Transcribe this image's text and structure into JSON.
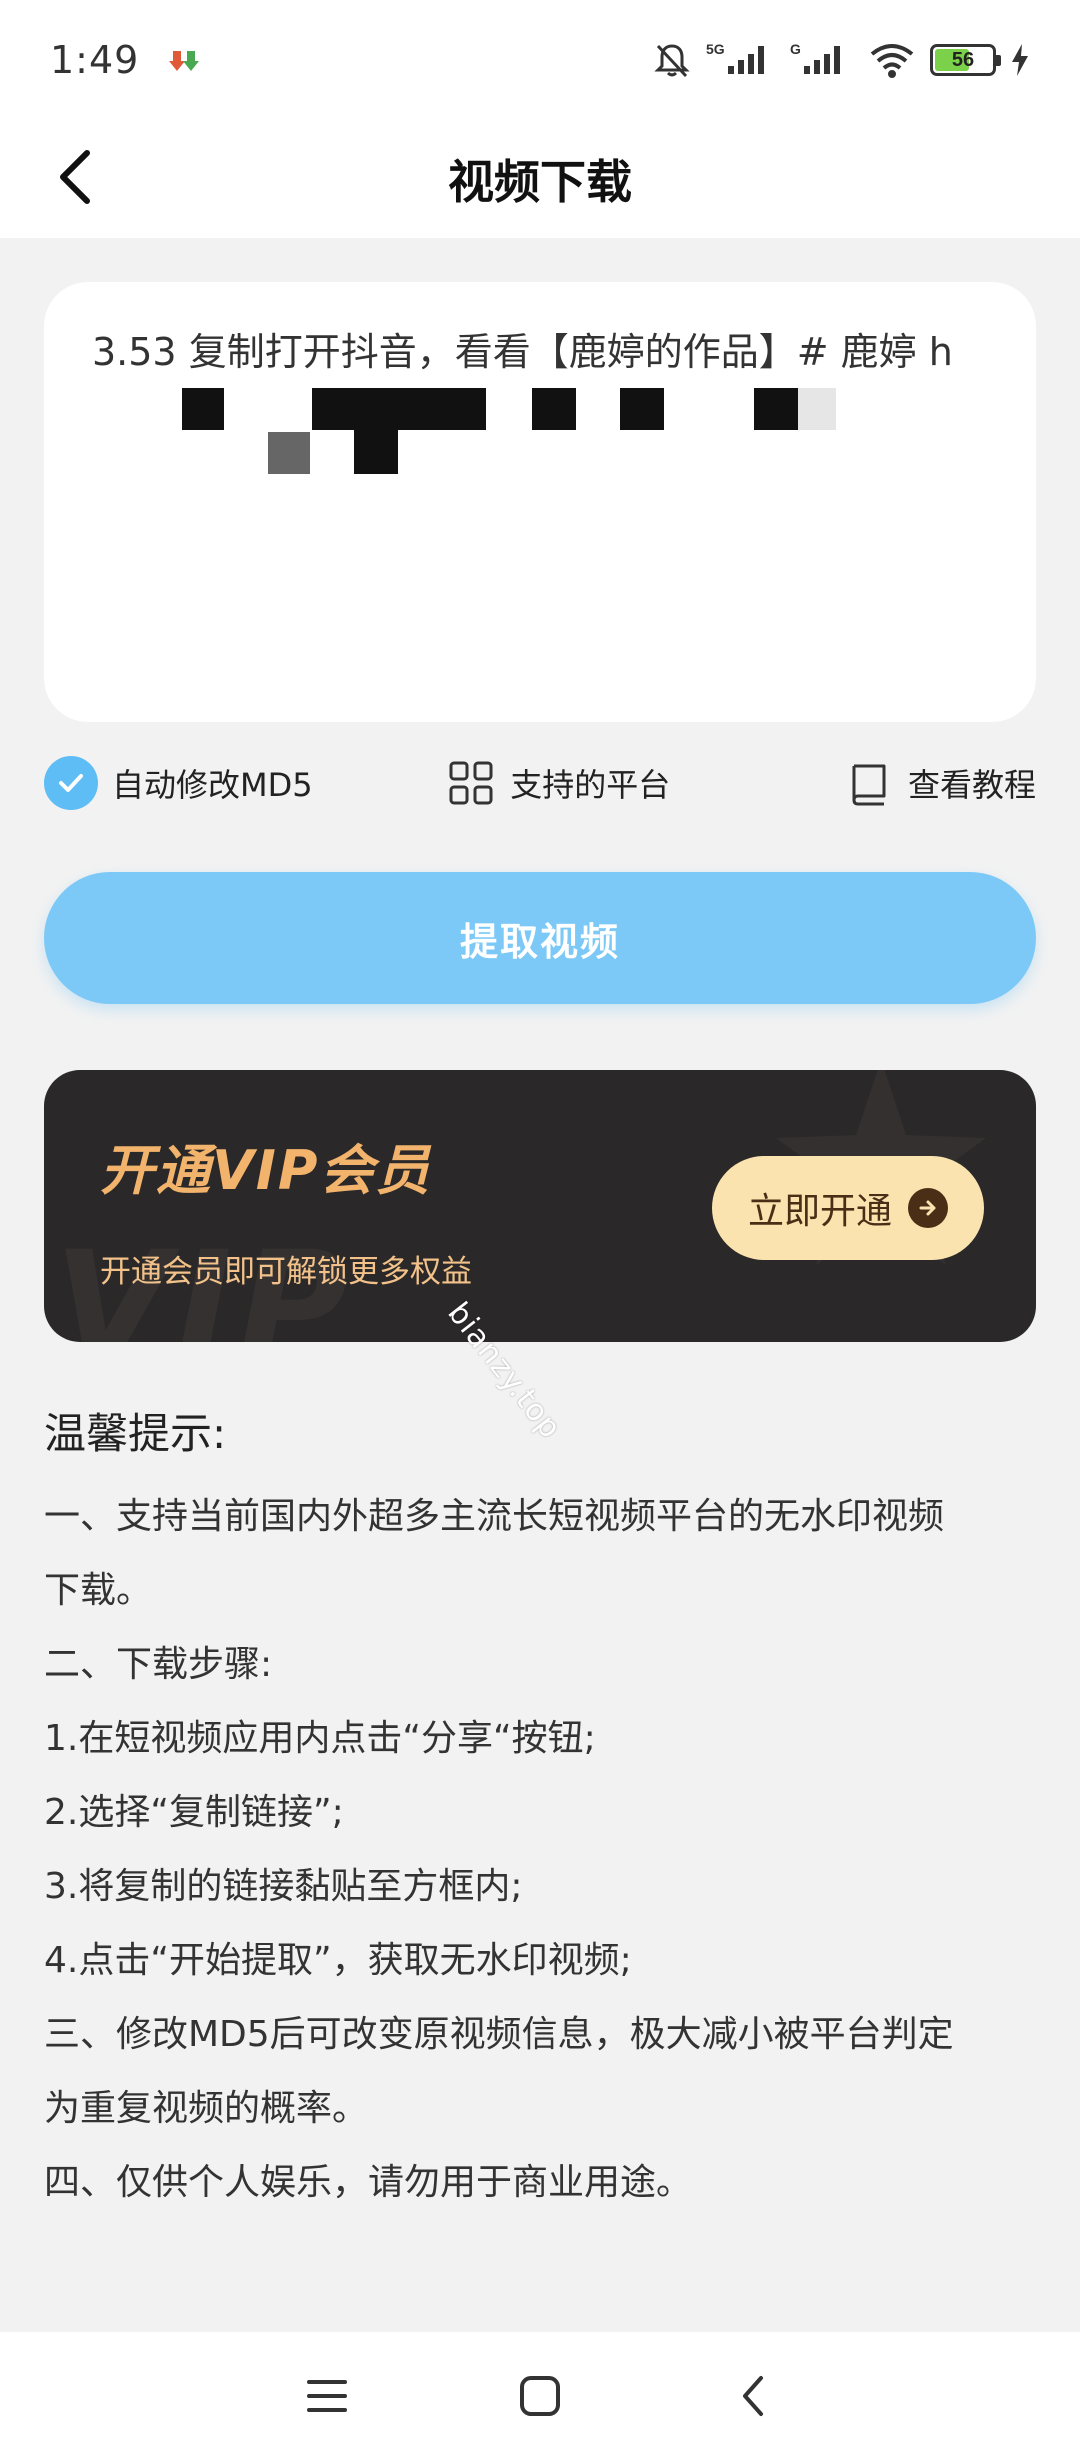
{
  "status_bar": {
    "time": "1:49",
    "battery_level": "56",
    "network_1": "5G",
    "network_2": "G"
  },
  "header": {
    "title": "视频下载"
  },
  "input": {
    "text": "3.53 复制打开抖音，看看【鹿婷的作品】# 鹿婷 h                PX:/ (",
    "redacted": true
  },
  "options": {
    "auto_md5_label": "自动修改MD5",
    "auto_md5_checked": true,
    "platforms_label": "支持的平台",
    "tutorial_label": "查看教程"
  },
  "extract_button": {
    "label": "提取视频"
  },
  "vip": {
    "title": "开通VIP会员",
    "subtitle": "开通会员即可解锁更多权益",
    "button_label": "立即开通",
    "background_text": "VIP"
  },
  "watermark": {
    "text": "bianzy.top"
  },
  "tips": {
    "title": "温馨提示:",
    "lines": [
      "一、支持当前国内外超多主流长短视频平台的无水印视频",
      "下载。",
      " 二、下载步骤:",
      "1.在短视频应用内点击“分享“按钮;",
      "2.选择“复制链接”;",
      "3.将复制的链接黏贴至方框内;",
      "4.点击“开始提取”，获取无水印视频;",
      " 三、修改MD5后可改变原视频信息，极大减小被平台判定",
      "为重复视频的概率。",
      " 四、仅供个人娱乐，请勿用于商业用途。"
    ]
  },
  "colors": {
    "accent_blue": "#5fbdf5",
    "button_blue": "#7cc9f7",
    "vip_gold": "#f2b36c",
    "vip_bg": "#2a2828"
  }
}
